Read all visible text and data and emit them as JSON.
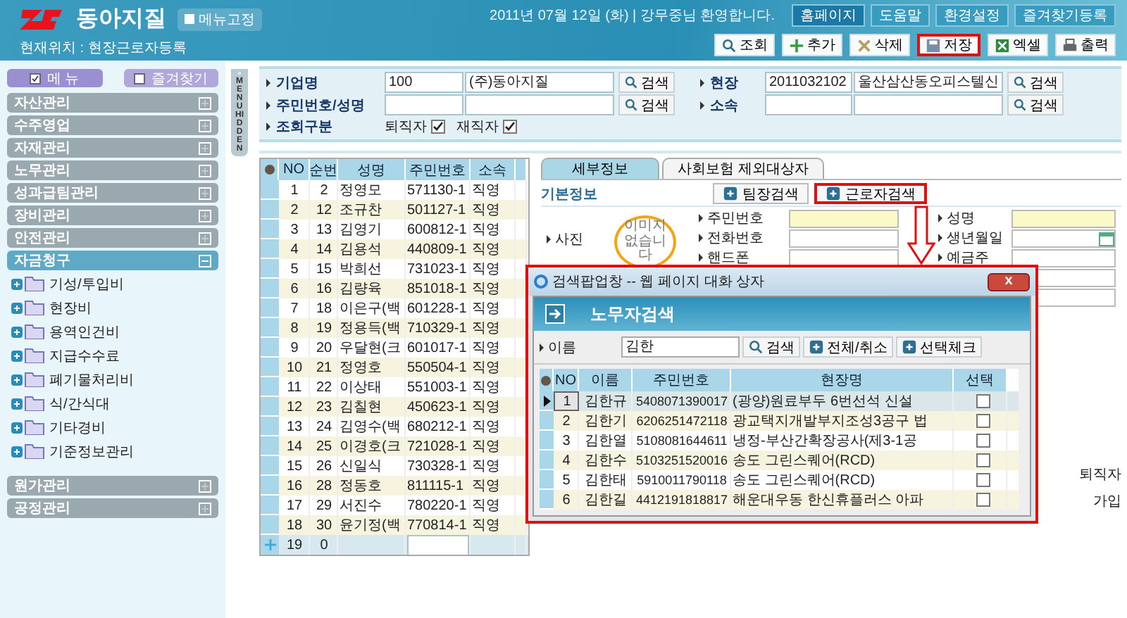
{
  "header": {
    "brand": "동아지질",
    "pin_button": "메뉴고정",
    "location": "현재위치 : 현장근로자등록",
    "greeting": "2011년 07월 12일 (화) | 강무중님 환영합니다.",
    "top_links": [
      {
        "label": "홈페이지",
        "selected": true
      },
      {
        "label": "도움말",
        "selected": false
      },
      {
        "label": "환경설정",
        "selected": false
      },
      {
        "label": "즐겨찾기등록",
        "selected": false
      }
    ],
    "toolbar": [
      {
        "kind": "search",
        "label": "조회",
        "highlighted": false
      },
      {
        "kind": "add",
        "label": "추가",
        "highlighted": false
      },
      {
        "kind": "delete",
        "label": "삭제",
        "highlighted": false
      },
      {
        "kind": "save",
        "label": "저장",
        "highlighted": true
      },
      {
        "kind": "excel",
        "label": "엑셀",
        "highlighted": false
      },
      {
        "kind": "print",
        "label": "출력",
        "highlighted": false
      }
    ]
  },
  "sidebar": {
    "tabs": [
      {
        "label": "메  뉴",
        "selected": true
      },
      {
        "label": "즐겨찾기",
        "selected": false
      }
    ],
    "toggle": "MENU HIDDEN",
    "items": [
      {
        "label": "자산관리",
        "expanded": false
      },
      {
        "label": "수주영업",
        "expanded": false
      },
      {
        "label": "자재관리",
        "expanded": false
      },
      {
        "label": "노무관리",
        "expanded": false
      },
      {
        "label": "성과급팀관리",
        "expanded": false
      },
      {
        "label": "장비관리",
        "expanded": false
      },
      {
        "label": "안전관리",
        "expanded": false
      },
      {
        "label": "자금청구",
        "expanded": true,
        "children": [
          {
            "label": "기성/투입비"
          },
          {
            "label": "현장비"
          },
          {
            "label": "용역인건비"
          },
          {
            "label": "지급수수료"
          },
          {
            "label": "폐기물처리비"
          },
          {
            "label": "식/간식대"
          },
          {
            "label": "기타경비"
          },
          {
            "label": "기준정보관리"
          }
        ]
      },
      {
        "label": "원가관리",
        "expanded": false
      },
      {
        "label": "공정관리",
        "expanded": false
      }
    ]
  },
  "filter": {
    "company": {
      "label": "기업명",
      "code": "100",
      "name": "(주)동아지질",
      "button": "검색"
    },
    "site": {
      "label": "현장",
      "code": "2011032102",
      "name": "울산삼산동오피스텔신",
      "button": "검색"
    },
    "person": {
      "label": "주민번호/성명",
      "button": "검색"
    },
    "dept": {
      "label": "소속",
      "button": "검색"
    },
    "status": {
      "label": "조회구분",
      "options": [
        {
          "label": "퇴직자",
          "checked": true
        },
        {
          "label": "재직자",
          "checked": true
        }
      ]
    }
  },
  "grid": {
    "columns": [
      "NO",
      "순번",
      "성명",
      "주민번호",
      "소속"
    ],
    "rows": [
      [
        "1",
        "2",
        "정영모",
        "571130-1",
        "직영"
      ],
      [
        "2",
        "12",
        "조규찬",
        "501127-1",
        "직영"
      ],
      [
        "3",
        "13",
        "김영기",
        "600812-1",
        "직영"
      ],
      [
        "4",
        "14",
        "김용석",
        "440809-1",
        "직영"
      ],
      [
        "5",
        "15",
        "박희선",
        "731023-1",
        "직영"
      ],
      [
        "6",
        "16",
        "김량육",
        "851018-1",
        "직영"
      ],
      [
        "7",
        "18",
        "이은구(백",
        "601228-1",
        "직영"
      ],
      [
        "8",
        "19",
        "정용득(백",
        "710329-1",
        "직영"
      ],
      [
        "9",
        "20",
        "우달현(크",
        "601017-1",
        "직영"
      ],
      [
        "10",
        "21",
        "정영호",
        "550504-1",
        "직영"
      ],
      [
        "11",
        "22",
        "이상태",
        "551003-1",
        "직영"
      ],
      [
        "12",
        "23",
        "김칠현",
        "450623-1",
        "직영"
      ],
      [
        "13",
        "24",
        "김영수(백",
        "680212-1",
        "직영"
      ],
      [
        "14",
        "25",
        "이경호(크",
        "721028-1",
        "직영"
      ],
      [
        "15",
        "26",
        "신일식",
        "730328-1",
        "직영"
      ],
      [
        "16",
        "28",
        "정동호",
        "811115-1",
        "직영"
      ],
      [
        "17",
        "29",
        "서진수",
        "780220-1",
        "직영"
      ],
      [
        "18",
        "30",
        "윤기정(백",
        "770814-1",
        "직영"
      ]
    ],
    "new_row": {
      "no": "19",
      "seq": "0"
    }
  },
  "detail": {
    "tabs": [
      {
        "label": "세부정보",
        "selected": true
      },
      {
        "label": "사회보험 제외대상자",
        "selected": false
      }
    ],
    "section": "기본정보",
    "buttons": [
      {
        "label": "팀장검색",
        "highlighted": false
      },
      {
        "label": "근로자검색",
        "highlighted": true
      }
    ],
    "photo_label": "사진",
    "no_image": "이미지 없습니다",
    "fields": [
      {
        "label": "주민번호",
        "kind": "required"
      },
      {
        "label": "성명",
        "kind": "required"
      },
      {
        "label": "전화번호",
        "kind": "plain"
      },
      {
        "label": "생년월일",
        "kind": "date"
      },
      {
        "label": "핸드폰",
        "kind": "plain"
      },
      {
        "label": "예금주",
        "kind": "plain"
      }
    ],
    "side_texts": [
      "퇴직자",
      "가입"
    ]
  },
  "popup": {
    "title": "검색팝업창 -- 웹 페이지 대화 상자",
    "close": "x",
    "heading": "노무자검색",
    "search_label": "이름",
    "search_value": "김한",
    "buttons": [
      {
        "kind": "search",
        "label": "검색"
      },
      {
        "kind": "plus",
        "label": "전체/취소"
      },
      {
        "kind": "plus",
        "label": "선택체크"
      }
    ],
    "columns": [
      "NO",
      "이름",
      "주민번호",
      "현장명",
      "선택"
    ],
    "rows": [
      {
        "no": "1",
        "name": "김한규",
        "id": "5408071390017",
        "site": "(광양)원료부두 6번선석 신설",
        "checked": false,
        "selected": true
      },
      {
        "no": "2",
        "name": "김한기",
        "id": "6206251472118",
        "site": "광교택지개발부지조성3공구 법",
        "checked": false,
        "selected": false
      },
      {
        "no": "3",
        "name": "김한열",
        "id": "5108081644611",
        "site": "냉정-부산간확장공사(제3-1공",
        "checked": false,
        "selected": false
      },
      {
        "no": "4",
        "name": "김한수",
        "id": "5103251520016",
        "site": "송도 그린스퀘어(RCD)",
        "checked": false,
        "selected": false
      },
      {
        "no": "5",
        "name": "김한태",
        "id": "5910011790118",
        "site": "송도 그린스퀘어(RCD)",
        "checked": false,
        "selected": false
      },
      {
        "no": "6",
        "name": "김한길",
        "id": "4412191818817",
        "site": "해운대우동 한신휴플러스 아파",
        "checked": false,
        "selected": false
      }
    ]
  }
}
